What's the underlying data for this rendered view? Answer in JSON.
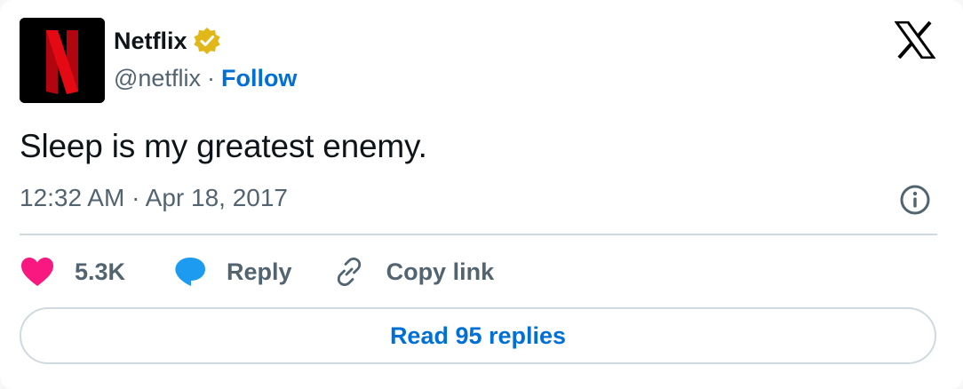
{
  "author": {
    "name": "Netflix",
    "handle": "@netflix",
    "separator": "·",
    "follow_label": "Follow",
    "verified_icon": "verified-badge-icon",
    "avatar_logo": "N"
  },
  "tweet": {
    "text": "Sleep is my greatest enemy.",
    "timestamp": "12:32 AM · Apr 18, 2017"
  },
  "actions": {
    "like_count": "5.3K",
    "reply_label": "Reply",
    "copy_link_label": "Copy link"
  },
  "read_replies_label": "Read 95 replies",
  "colors": {
    "brand_red": "#e50914",
    "link_blue": "#006fd6",
    "like_pink": "#f91880",
    "reply_blue": "#1d9bf0",
    "muted_text": "#536471",
    "verified_gold": "#e2b719"
  }
}
